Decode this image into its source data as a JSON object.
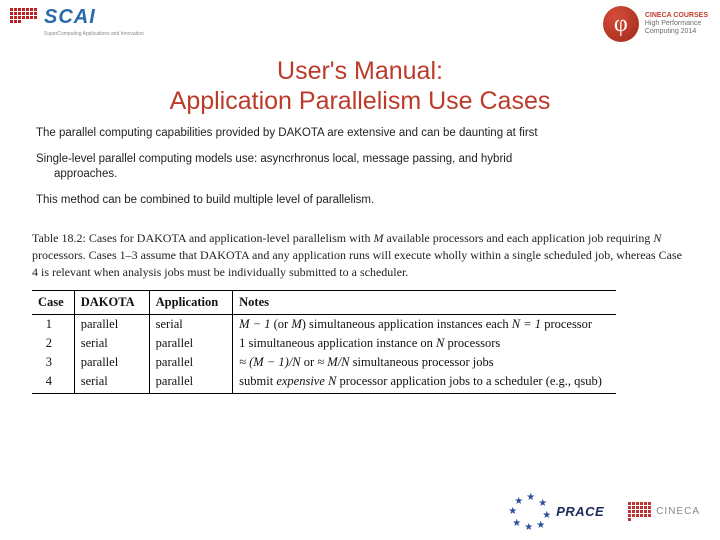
{
  "logos": {
    "left_main": "SCAI",
    "left_sub": "SuperComputing Applications and Innovation",
    "right_line1": "CINECA COURSES",
    "right_line2": "High Performance",
    "right_line3": "Computing 2014",
    "phi": "φ"
  },
  "title": {
    "line1": "User's Manual:",
    "line2": "Application Parallelism Use Cases"
  },
  "paragraphs": {
    "p1": "The parallel computing capabilities provided by DAKOTA are extensive and can be daunting at first",
    "p2a": "Single-level parallel computing models use: asyncrhronus local, message passing, and hybrid",
    "p2b": "approaches.",
    "p3": "This method can be combined to build multiple level of parallelism."
  },
  "table_caption": {
    "prefix": "Table 18.2: Cases for DAKOTA and application-level parallelism with ",
    "mid1": " available processors and each application job requiring ",
    "mid2": " processors. Cases 1–3 assume that DAKOTA and any application runs will execute wholly within a single scheduled job, whereas Case 4 is relevant when analysis jobs must be individually submitted to a scheduler."
  },
  "table": {
    "headers": {
      "c1": "Case",
      "c2": "DAKOTA",
      "c3": "Application",
      "c4": "Notes"
    },
    "rows": [
      {
        "case": "1",
        "dakota": "parallel",
        "app": "serial",
        "notes_pre": "M − 1",
        "notes_mid": " (or ",
        "notes_mid2": "M",
        "notes_mid3": ") simultaneous application instances each ",
        "notes_suf": "N = 1",
        "notes_end": " processor"
      },
      {
        "case": "2",
        "dakota": "serial",
        "app": "parallel",
        "notes": "1 simultaneous application instance on ",
        "notes_var": "N",
        "notes_end": " processors"
      },
      {
        "case": "3",
        "dakota": "parallel",
        "app": "parallel",
        "notes_pre": "≈ (M − 1)/N",
        "notes_mid": " or ",
        "notes_mid2": "≈ M/N",
        "notes_end": " simultaneous processor jobs"
      },
      {
        "case": "4",
        "dakota": "serial",
        "app": "parallel",
        "notes_pre": "submit ",
        "notes_ital": "expensive N",
        "notes_end": " processor application jobs to a scheduler (e.g., qsub)"
      }
    ]
  },
  "footer": {
    "prace": "PRACE",
    "cineca": "CINECA"
  }
}
